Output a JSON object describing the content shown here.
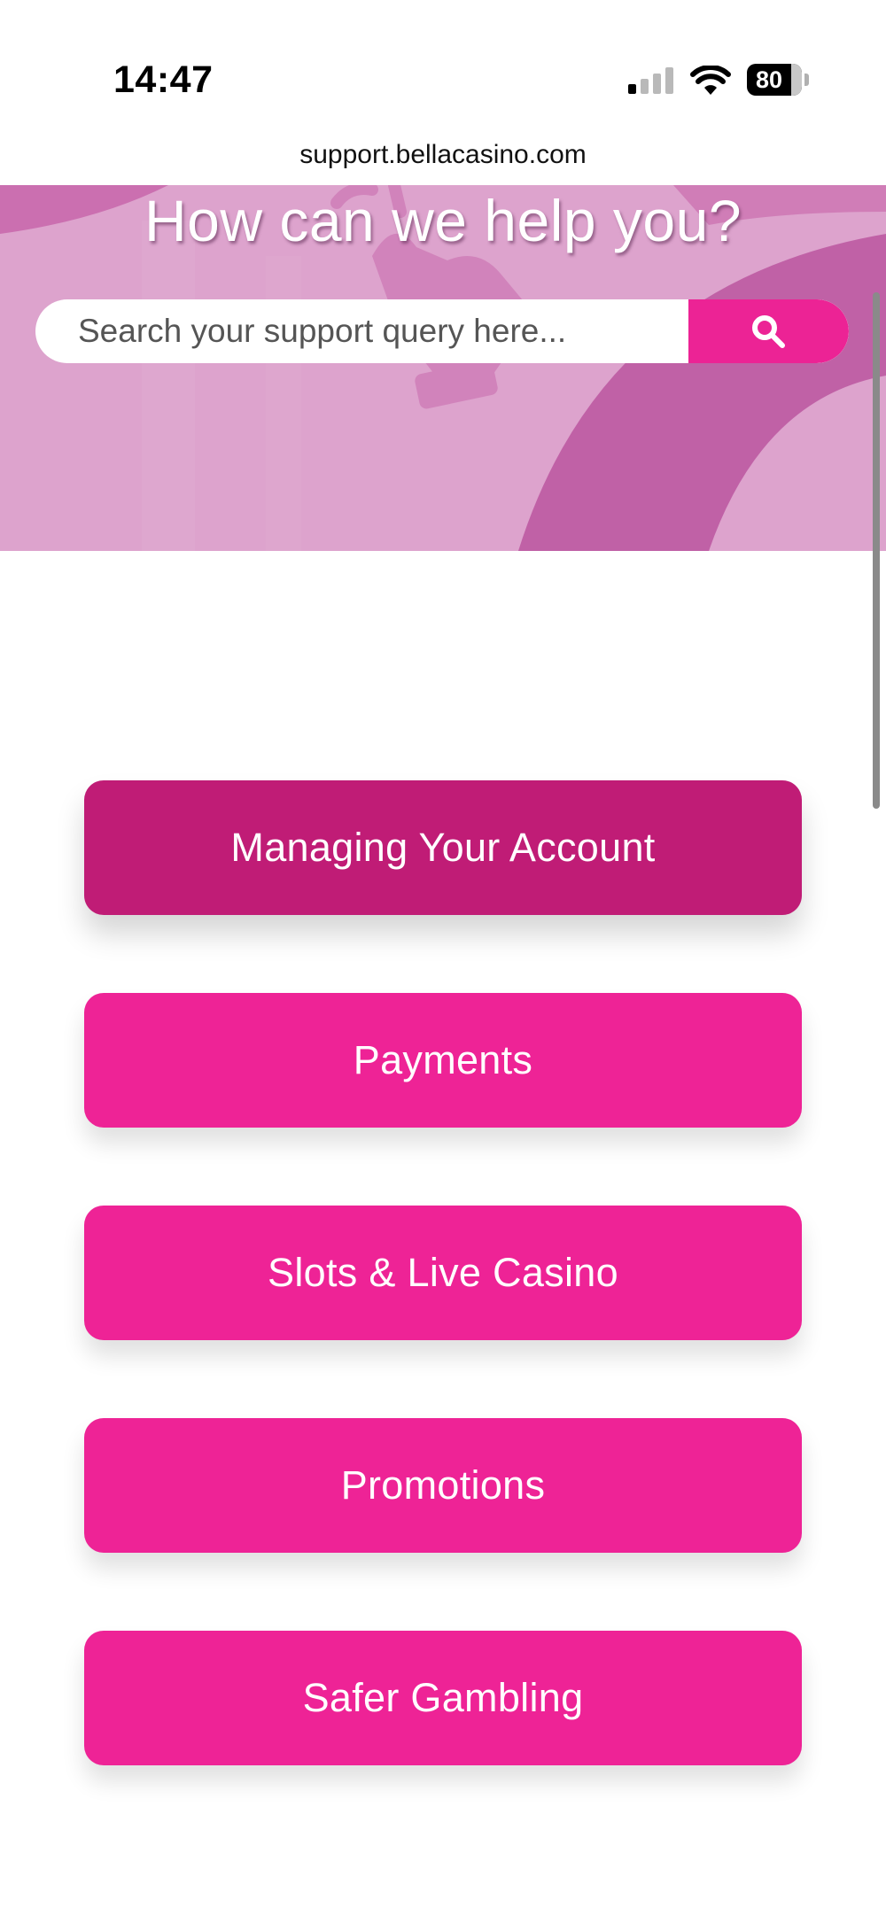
{
  "status_bar": {
    "time": "14:47",
    "battery_level": "80",
    "icons": [
      "signal-icon",
      "wifi-icon",
      "battery-icon"
    ]
  },
  "browser": {
    "url": "support.bellacasino.com"
  },
  "hero": {
    "title": "How can we help you?",
    "background_color": "#dda3cd"
  },
  "search": {
    "placeholder": "Search your support query here...",
    "button_icon": "search-icon",
    "button_color": "#ec2395"
  },
  "categories": [
    {
      "label": "Managing Your Account",
      "state": "active"
    },
    {
      "label": "Payments"
    },
    {
      "label": "Slots & Live Casino"
    },
    {
      "label": "Promotions"
    },
    {
      "label": "Safer Gambling"
    }
  ],
  "colors": {
    "accent": "#ee2396",
    "accent_active": "#c01c76"
  }
}
